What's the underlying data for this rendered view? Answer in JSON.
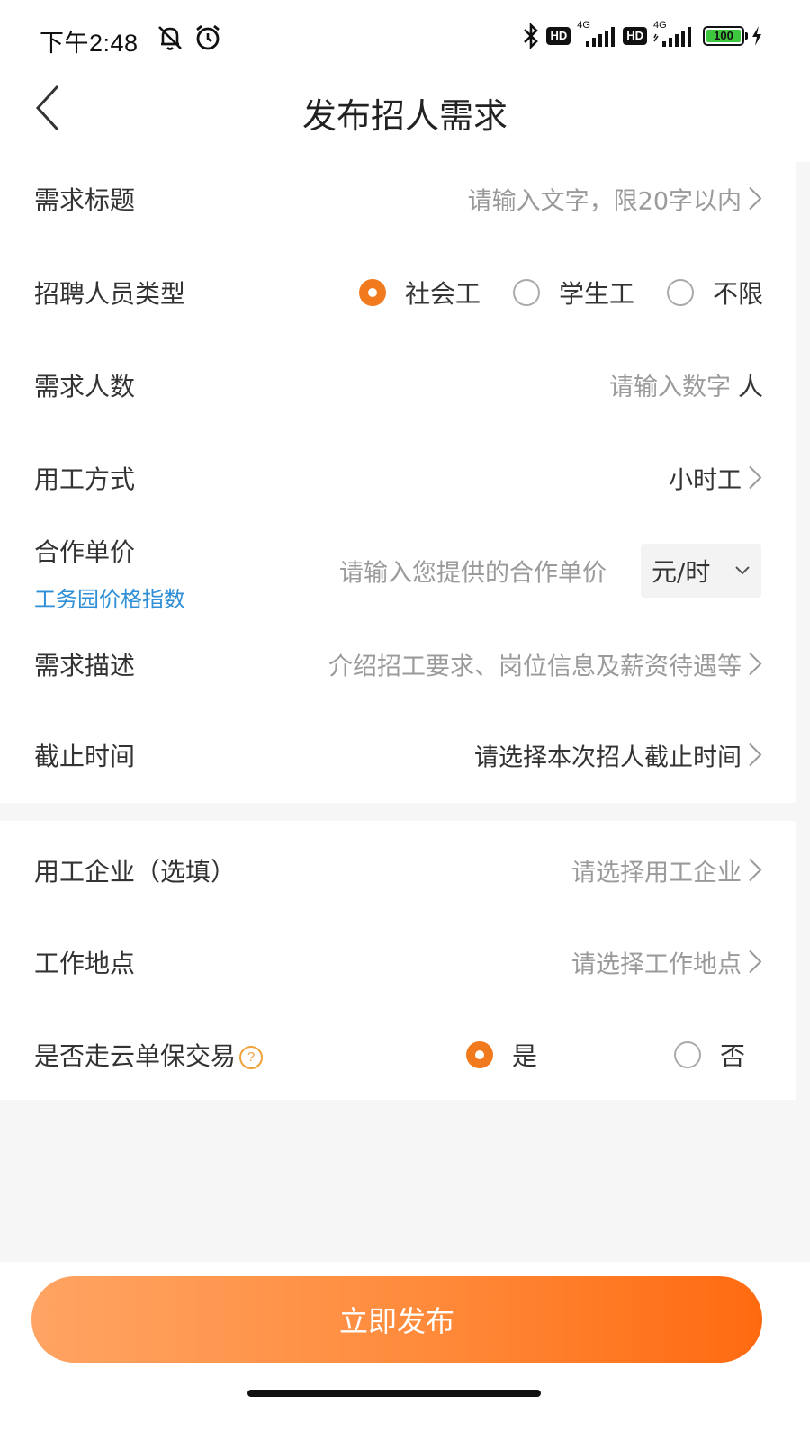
{
  "status": {
    "time": "下午2:48",
    "hd1": "HD",
    "net1": "4G",
    "hd2": "HD",
    "net2": "4G",
    "battery": "100"
  },
  "header": {
    "title": "发布招人需求"
  },
  "form": {
    "title_row": {
      "label": "需求标题",
      "placeholder": "请输入文字，限20字以内"
    },
    "type_row": {
      "label": "招聘人员类型",
      "options": [
        "社会工",
        "学生工",
        "不限"
      ],
      "selected": "社会工"
    },
    "count_row": {
      "label": "需求人数",
      "placeholder": "请输入数字",
      "unit": "人"
    },
    "mode_row": {
      "label": "用工方式",
      "value": "小时工"
    },
    "price_row": {
      "label": "合作单价",
      "link": "工务园价格指数",
      "placeholder": "请输入您提供的合作单价",
      "unit": "元/时"
    },
    "desc_row": {
      "label": "需求描述",
      "placeholder": "介绍招工要求、岗位信息及薪资待遇等"
    },
    "deadline_row": {
      "label": "截止时间",
      "placeholder": "请选择本次招人截止时间"
    },
    "company_row": {
      "label": "用工企业（选填）",
      "placeholder": "请选择用工企业"
    },
    "location_row": {
      "label": "工作地点",
      "placeholder": "请选择工作地点"
    },
    "guarantee_row": {
      "label": "是否走云单保交易",
      "help": "?",
      "options": [
        "是",
        "否"
      ],
      "selected": "是"
    }
  },
  "actions": {
    "submit_label": "立即发布"
  },
  "colors": {
    "accent": "#f27a1e",
    "link": "#2f8fd6"
  }
}
